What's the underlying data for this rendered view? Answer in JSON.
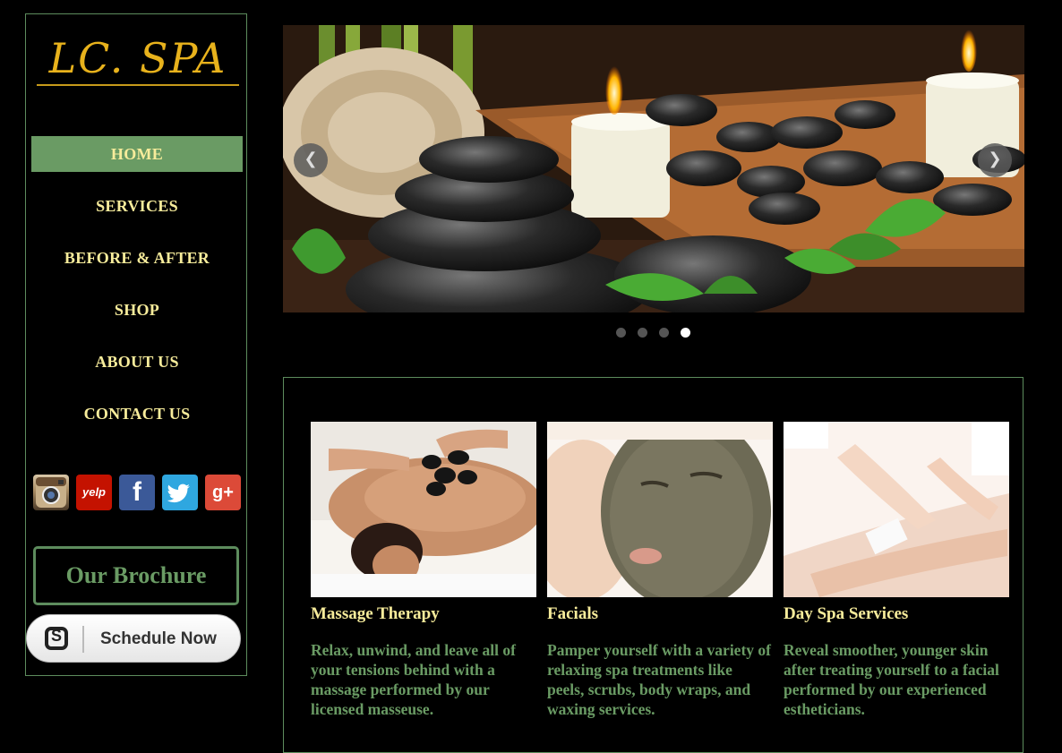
{
  "logo": {
    "text": "LC. SPA"
  },
  "nav": {
    "items": [
      {
        "label": "HOME",
        "active": true
      },
      {
        "label": "SERVICES",
        "active": false
      },
      {
        "label": "BEFORE & AFTER",
        "active": false
      },
      {
        "label": "SHOP",
        "active": false
      },
      {
        "label": "ABOUT US",
        "active": false
      },
      {
        "label": "CONTACT US",
        "active": false
      }
    ]
  },
  "social": [
    {
      "name": "instagram-icon",
      "glyph": "◉"
    },
    {
      "name": "yelp-icon",
      "glyph": "yelp"
    },
    {
      "name": "facebook-icon",
      "glyph": "f"
    },
    {
      "name": "twitter-icon",
      "glyph": "t"
    },
    {
      "name": "google-plus-icon",
      "glyph": "g+"
    }
  ],
  "brochure": {
    "label": "Our Brochure"
  },
  "schedule": {
    "label": "Schedule Now"
  },
  "slider": {
    "prev_glyph": "❮",
    "next_glyph": "❯",
    "dot_count": 4,
    "active_index": 3
  },
  "services": [
    {
      "title": "Massage Therapy",
      "desc": "Relax, unwind, and leave all of your tensions behind with a massage performed by our licensed masseuse."
    },
    {
      "title": "Facials",
      "desc": "Pamper yourself with a variety of relaxing spa treatments like peels, scrubs, body wraps, and waxing services."
    },
    {
      "title": "Day Spa Services",
      "desc": "Reveal smoother, younger skin after treating yourself to a facial performed by our experienced estheticians."
    }
  ],
  "colors": {
    "accent": "#6a9b64",
    "nav_text": "#f7ec9b",
    "logo": "#e8b21c",
    "border": "#5d8c5d"
  }
}
